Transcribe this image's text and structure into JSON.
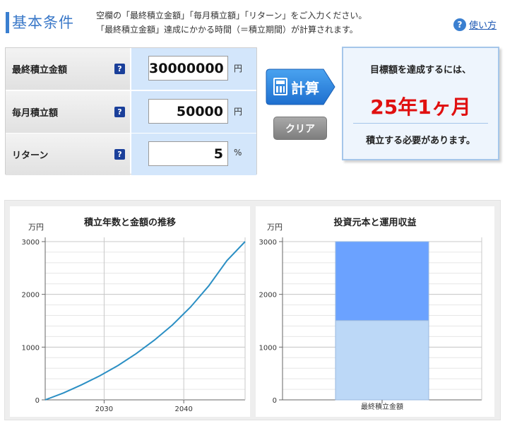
{
  "header": {
    "title": "基本条件",
    "desc_line1": "空欄の「最終積立金額」「毎月積立額」「リターン」をご入力ください。",
    "desc_line2": "「最終積立金額」達成にかかる時間（＝積立期間）が計算されます。",
    "help_icon": "?",
    "help_label": "使い方"
  },
  "form": {
    "rows": [
      {
        "label": "最終積立金額",
        "value": "30000000",
        "unit": "円"
      },
      {
        "label": "毎月積立額",
        "value": "50000",
        "unit": "円"
      },
      {
        "label": "リターン",
        "value": "5",
        "unit": "%"
      }
    ],
    "help_mark": "?"
  },
  "buttons": {
    "calc": "計算",
    "clear": "クリア"
  },
  "result": {
    "heading": "目標額を達成するには、",
    "value": "25年1ヶ月",
    "footer": "積立する必要があります。"
  },
  "colors": {
    "accent": "#3a7fd0",
    "result_red": "#e01010",
    "line": "#2b8fc4",
    "bar_top": "#6ba2ff",
    "bar_bottom": "#bcd8f7"
  },
  "chart_data": [
    {
      "type": "line",
      "title": "積立年数と金額の推移",
      "ylabel": "万円",
      "xlabel": "",
      "x_ticks": [
        2030,
        2040
      ],
      "y_ticks": [
        0,
        1000,
        2000,
        3000
      ],
      "xlim": [
        2022.6,
        2047.7
      ],
      "ylim": [
        0,
        3000
      ],
      "grid": true,
      "x": [
        2022.6,
        2025,
        2027.5,
        2030,
        2032.5,
        2035,
        2037.5,
        2040,
        2042.5,
        2045,
        2047.7
      ],
      "y": [
        0,
        130,
        285,
        455,
        650,
        875,
        1130,
        1420,
        1760,
        2160,
        2640,
        3000
      ]
    },
    {
      "type": "bar",
      "title": "投資元本と運用収益",
      "ylabel": "万円",
      "categories": [
        "最終積立金額"
      ],
      "y_ticks": [
        0,
        1000,
        2000,
        3000
      ],
      "ylim": [
        0,
        3000
      ],
      "grid": true,
      "stacked": true,
      "series": [
        {
          "values": [
            1505
          ]
        },
        {
          "values": [
            1495
          ]
        }
      ]
    }
  ]
}
